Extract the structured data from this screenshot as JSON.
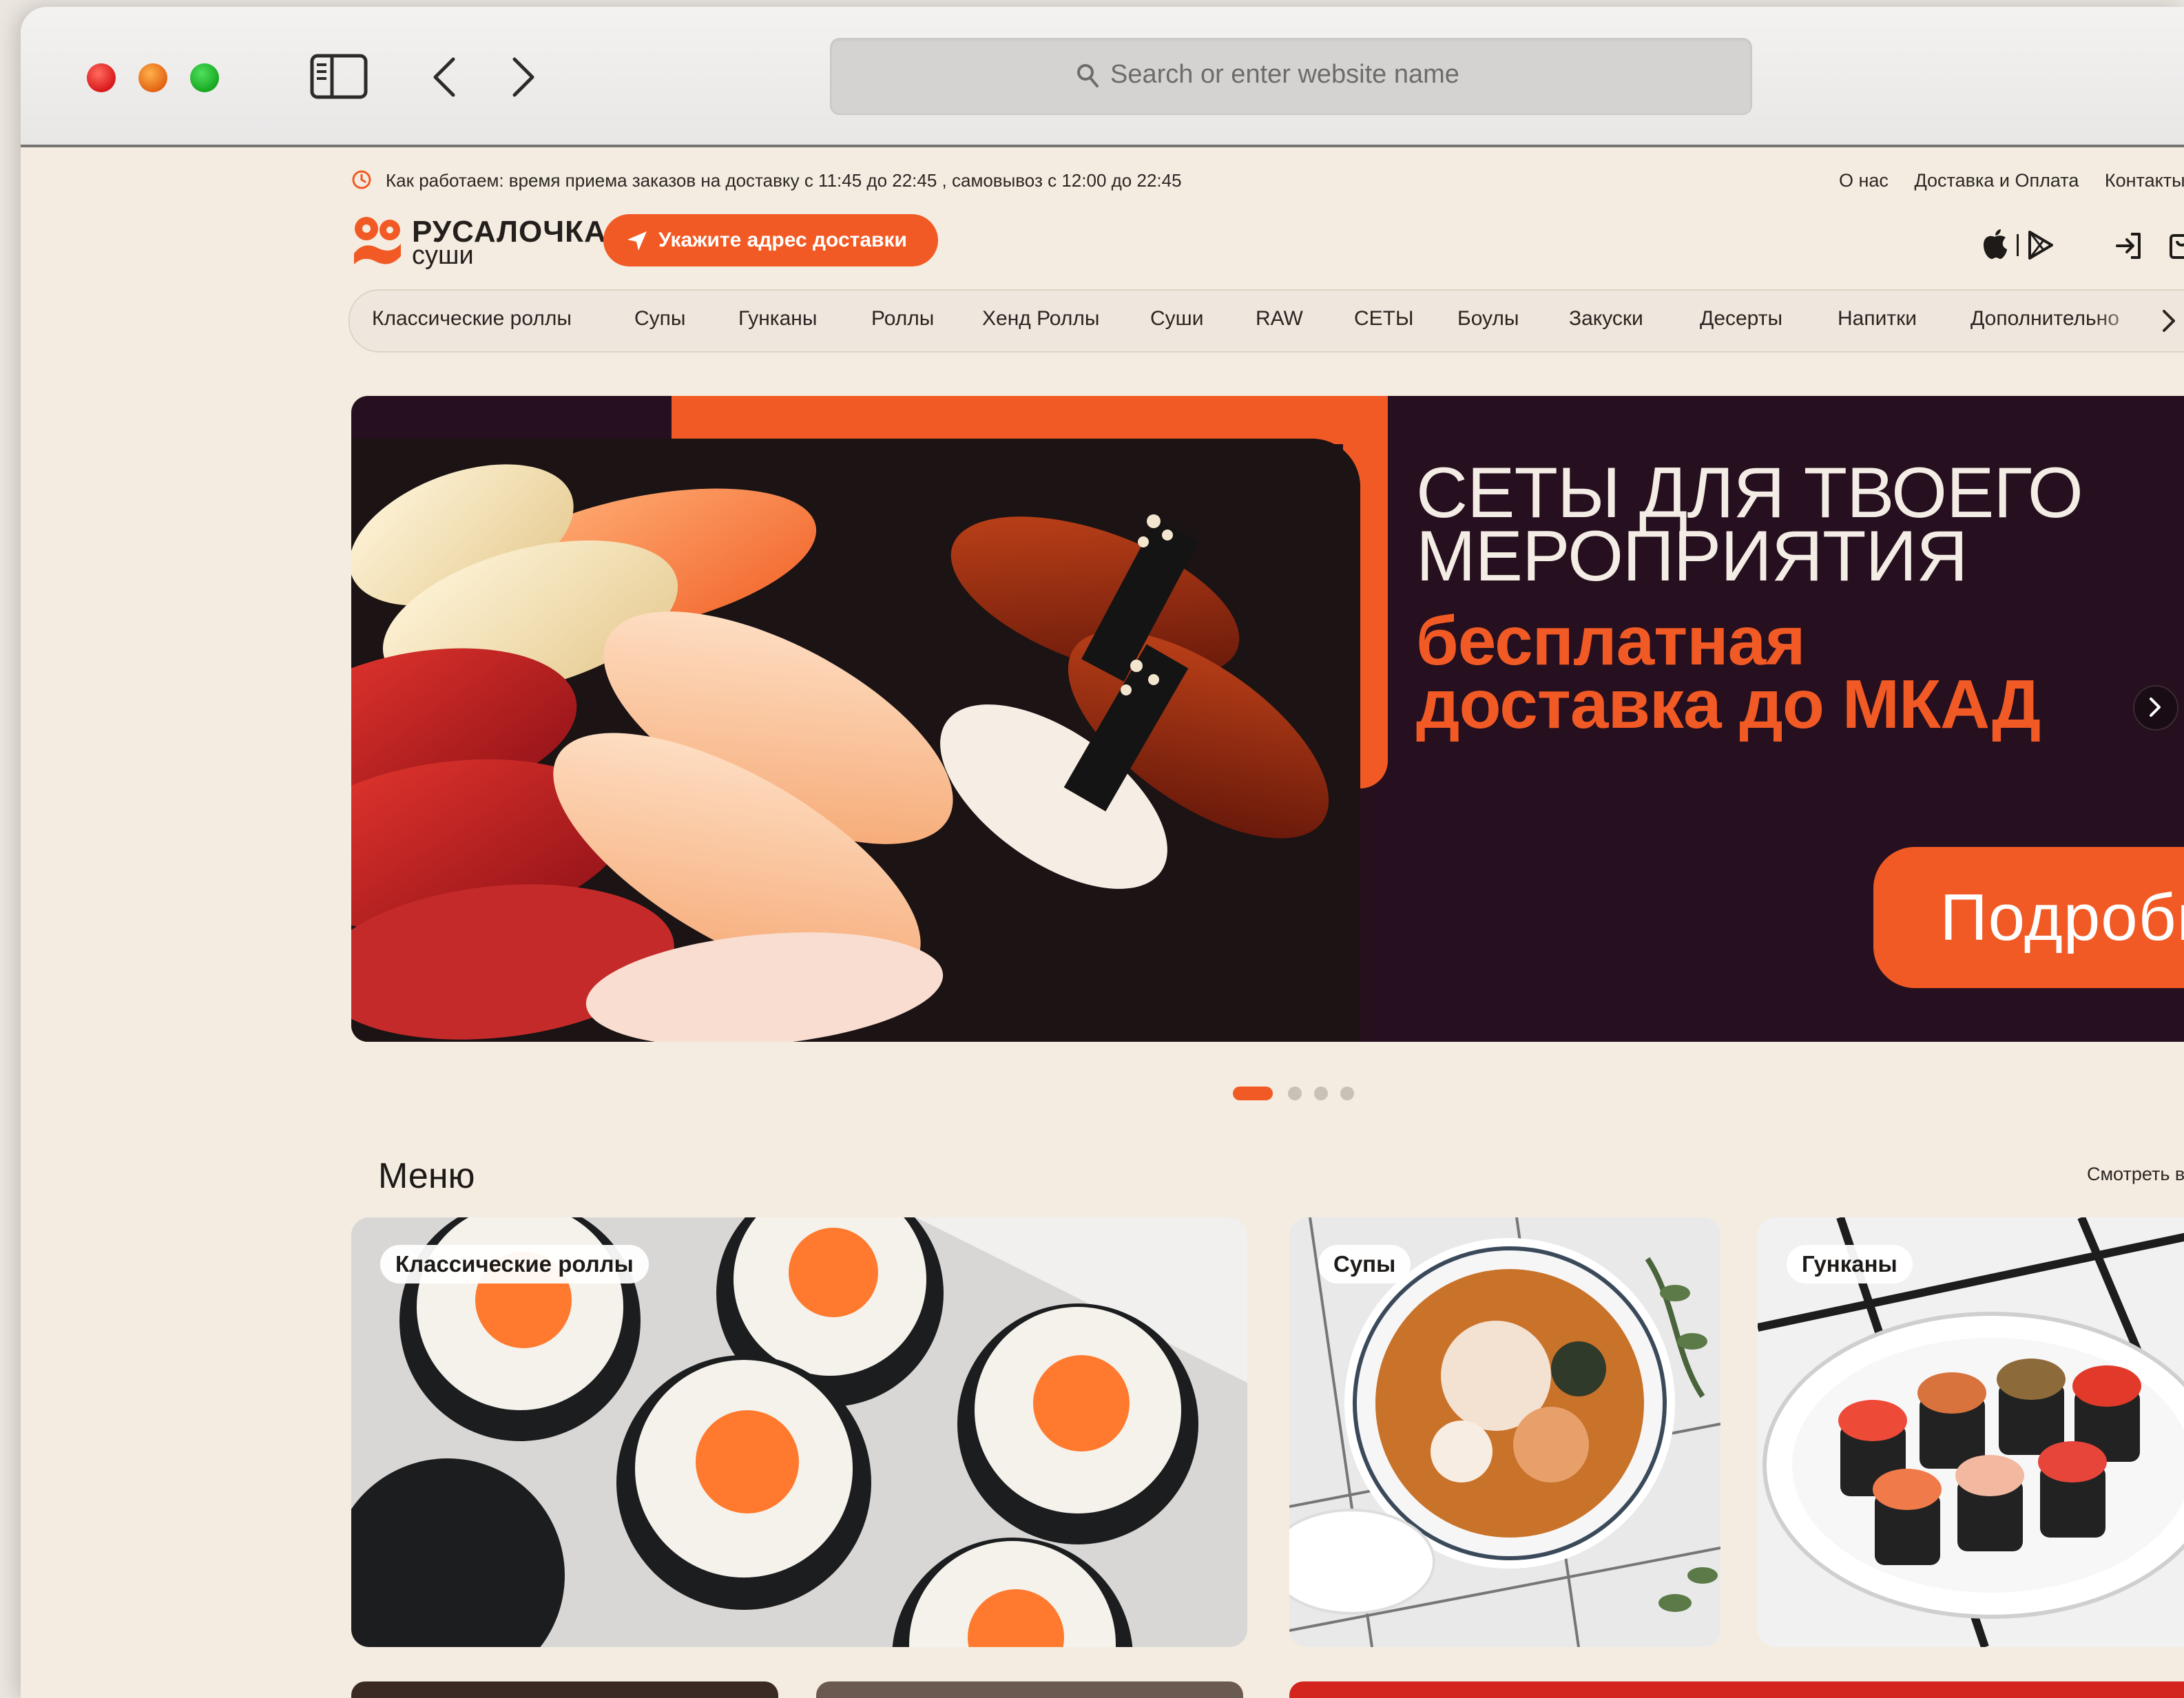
{
  "browser": {
    "search_placeholder": "Search or enter website name"
  },
  "infobar": {
    "hours_text": "Как работаем: время приема заказов на доставку с 11:45 до 22:45 , самовывоз с 12:00 до 22:45",
    "links": [
      "О нас",
      "Доставка и Оплата",
      "Контакты"
    ]
  },
  "brand": {
    "name": "РУСАЛОЧКА",
    "subtitle": "суши",
    "accent_color": "#f15a24"
  },
  "header": {
    "address_button": "Укажите адрес доставки"
  },
  "categories": [
    "Классические роллы",
    "Супы",
    "Гунканы",
    "Роллы",
    "Хенд Роллы",
    "Суши",
    "RAW",
    "СЕТЫ",
    "Боулы",
    "Закуски",
    "Десерты",
    "Напитки",
    "Дополнительно"
  ],
  "hero": {
    "title": "СЕТЫ ДЛЯ ТВОЕГО\nМЕРОПРИЯТИЯ",
    "subtitle": "бесплатная\nдоставка до МКАД",
    "button": "Подробнее",
    "slides_total": 4,
    "active_slide": 1
  },
  "menu": {
    "title": "Меню",
    "see_all": "Смотреть все",
    "cards": [
      {
        "label": "Классические роллы"
      },
      {
        "label": "Супы"
      },
      {
        "label": "Гунканы"
      }
    ]
  }
}
